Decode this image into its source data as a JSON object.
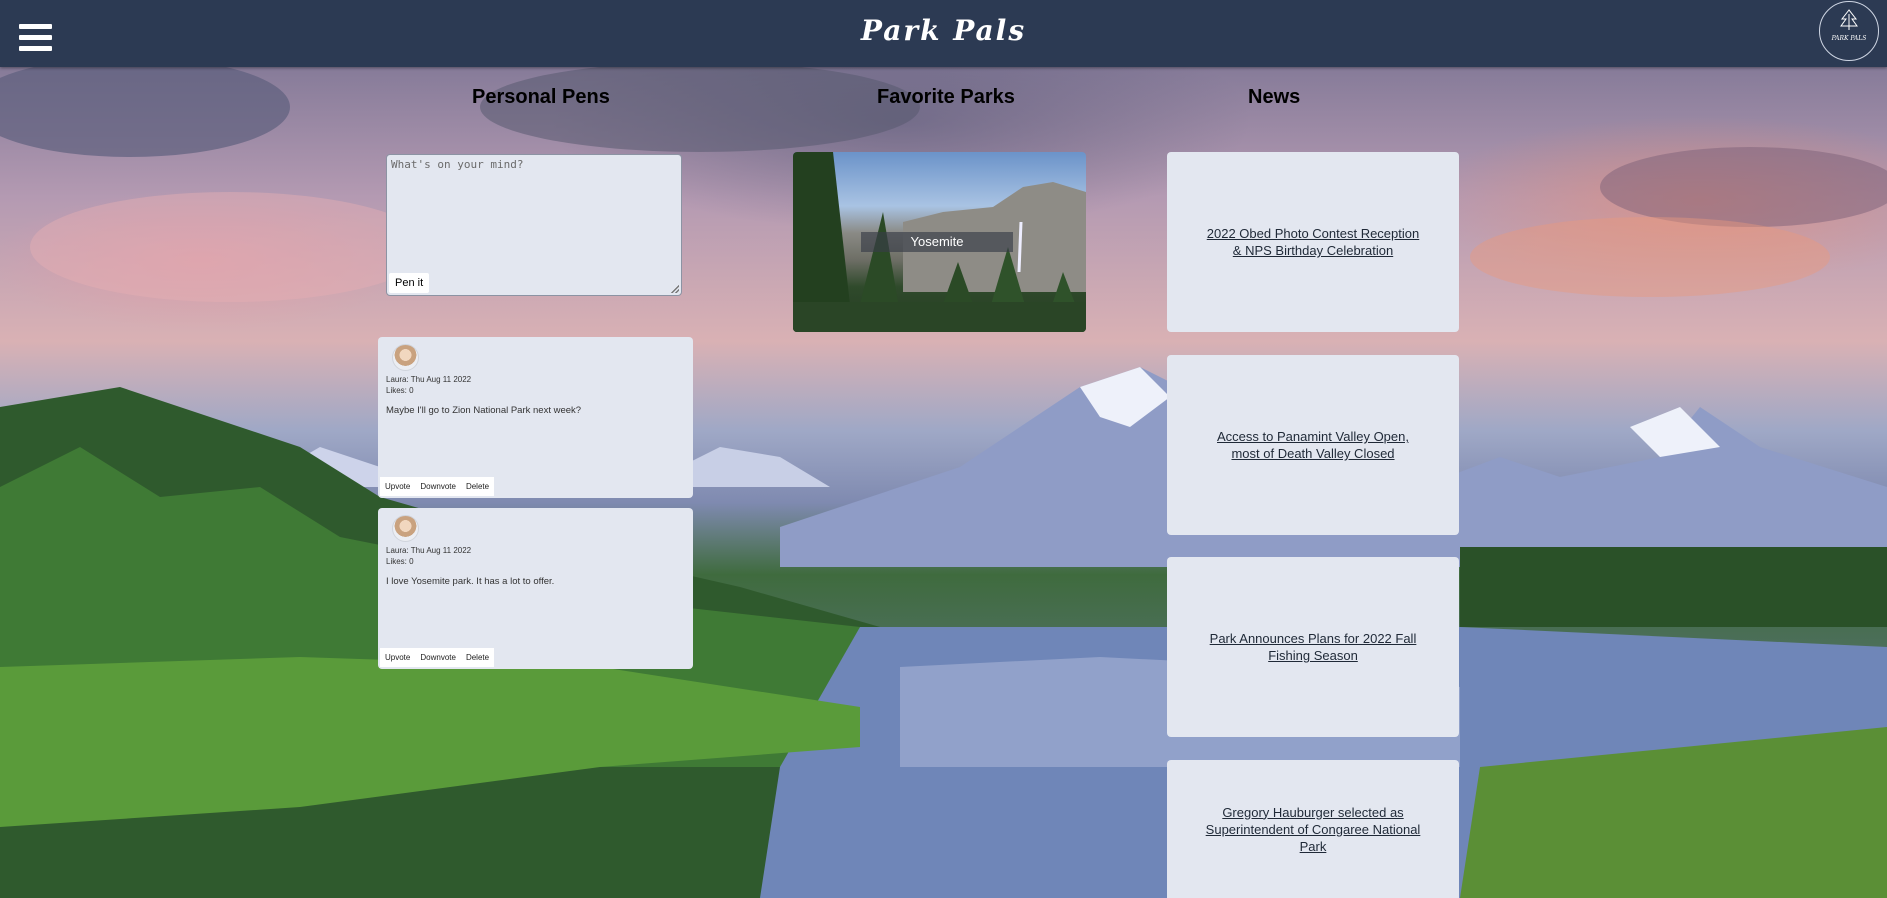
{
  "header": {
    "brand": "Park Pals",
    "menu_icon": "hamburger-menu-icon",
    "logo_icon": "pine-tree-icon",
    "logo_text": "PARK PALS",
    "background_color": "#2c3a53"
  },
  "columns": {
    "personal_pens": "Personal Pens",
    "favorite_parks": "Favorite Parks",
    "news": "News"
  },
  "composer": {
    "placeholder": "What's on your mind?",
    "value": "",
    "submit_label": "Pen it"
  },
  "posts": [
    {
      "author_date": "Laura: Thu Aug 11 2022",
      "likes": "Likes: 0",
      "body": "Maybe I'll go to Zion National Park next week?",
      "actions": [
        "Upvote",
        "Downvote",
        "Delete"
      ]
    },
    {
      "author_date": "Laura: Thu Aug 11 2022",
      "likes": "Likes: 0",
      "body": "I love Yosemite park. It has a lot to offer.",
      "actions": [
        "Upvote",
        "Downvote",
        "Delete"
      ]
    }
  ],
  "favorite_parks": [
    {
      "name": "Yosemite"
    }
  ],
  "news": [
    {
      "title": "2022 Obed Photo Contest Reception & NPS Birthday Celebration"
    },
    {
      "title": "Access to Panamint Valley Open, most of Death Valley Closed"
    },
    {
      "title": "Park Announces Plans for 2022 Fall Fishing Season"
    },
    {
      "title": "Gregory Hauburger selected as Superintendent of Congaree National Park"
    }
  ],
  "colors": {
    "card_background": "#e3e7f0",
    "text": "#1f2937"
  }
}
